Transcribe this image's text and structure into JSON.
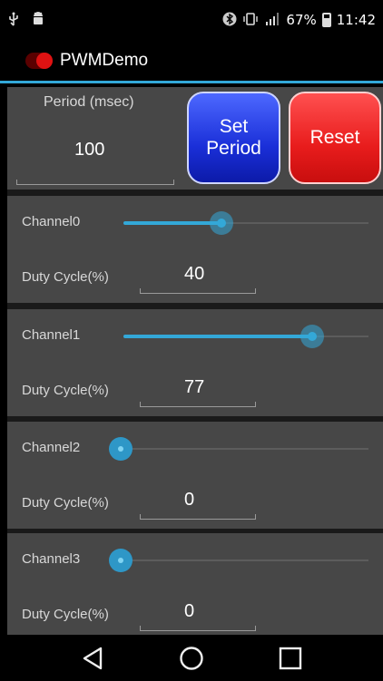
{
  "status_bar": {
    "battery_percent": "67%",
    "time": "11:42",
    "icons": [
      "usb-icon",
      "android-debug-icon",
      "bluetooth-icon",
      "vibrate-icon",
      "signal-icon",
      "battery-icon"
    ]
  },
  "app": {
    "title": "PWMDemo",
    "accent_color": "#33a8d8"
  },
  "period": {
    "label": "Period (msec)",
    "value": "100"
  },
  "buttons": {
    "set_period_line1": "Set",
    "set_period_line2": "Period",
    "reset": "Reset",
    "set_color": "#1a2fd8",
    "reset_color": "#e81c1c"
  },
  "channels": [
    {
      "label": "Channel0",
      "duty_label": "Duty Cycle(%)",
      "duty_value": "40",
      "level": 0.4
    },
    {
      "label": "Channel1",
      "duty_label": "Duty Cycle(%)",
      "duty_value": "77",
      "level": 0.77
    },
    {
      "label": "Channel2",
      "duty_label": "Duty Cycle(%)",
      "duty_value": "0",
      "level": 0.0
    },
    {
      "label": "Channel3",
      "duty_label": "Duty Cycle(%)",
      "duty_value": "0",
      "level": 0.0
    }
  ],
  "nav": {
    "icons": [
      "back-icon",
      "home-icon",
      "recents-icon"
    ]
  }
}
